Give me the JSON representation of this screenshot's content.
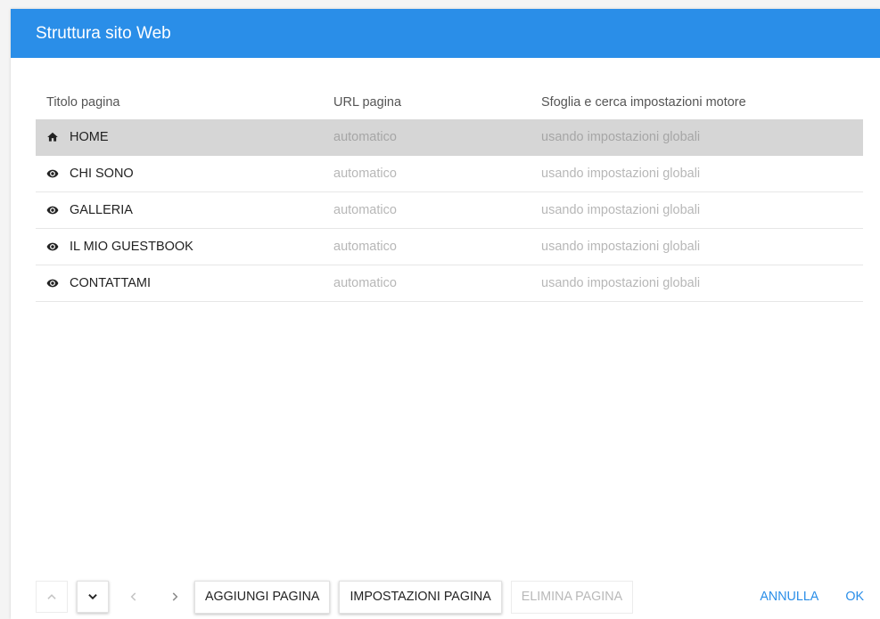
{
  "dialog": {
    "title": "Struttura sito Web"
  },
  "table": {
    "columns": [
      "Titolo pagina",
      "URL pagina",
      "Sfoglia e cerca impostazioni motore"
    ],
    "rows": [
      {
        "icon": "home-icon",
        "title": "HOME",
        "url": "automatico",
        "seo": "usando impostazioni globali",
        "selected": true
      },
      {
        "icon": "eye-icon",
        "title": "CHI SONO",
        "url": "automatico",
        "seo": "usando impostazioni globali",
        "selected": false
      },
      {
        "icon": "eye-icon",
        "title": "GALLERIA",
        "url": "automatico",
        "seo": "usando impostazioni globali",
        "selected": false
      },
      {
        "icon": "eye-icon",
        "title": "IL MIO GUESTBOOK",
        "url": "automatico",
        "seo": "usando impostazioni globali",
        "selected": false
      },
      {
        "icon": "eye-icon",
        "title": "CONTATTAMI",
        "url": "automatico",
        "seo": "usando impostazioni globali",
        "selected": false
      }
    ]
  },
  "footer": {
    "add_page": "AGGIUNGI PAGINA",
    "page_settings": "IMPOSTAZIONI PAGINA",
    "delete_page": "ELIMINA PAGINA",
    "cancel": "ANNULLA",
    "ok": "OK"
  },
  "colors": {
    "accent": "#2a8ee8",
    "selected_row": "#d6d6d6"
  }
}
